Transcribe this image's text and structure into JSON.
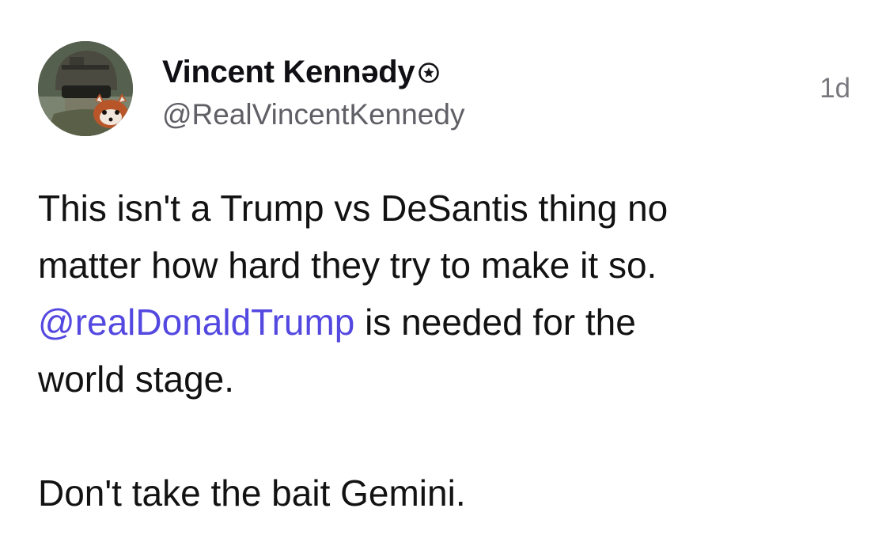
{
  "post": {
    "author": {
      "display_name": "Vincent Kennədy",
      "badge_icon": "star-circle-icon",
      "handle": "@RealVincentKennedy",
      "avatar_icon": "avatar-soldier-with-red-panda"
    },
    "timestamp": "1d",
    "body": {
      "line1": "This isn't a Trump vs DeSantis thing no",
      "line2": "matter how hard they try to make it so.",
      "mention": "@realDonaldTrump",
      "after_mention": " is needed for the",
      "line4": "world stage.",
      "line5": "Don't take the bait Gemini."
    },
    "colors": {
      "mention": "#5348e0",
      "text": "#121212",
      "secondary": "#5f5f66"
    }
  }
}
